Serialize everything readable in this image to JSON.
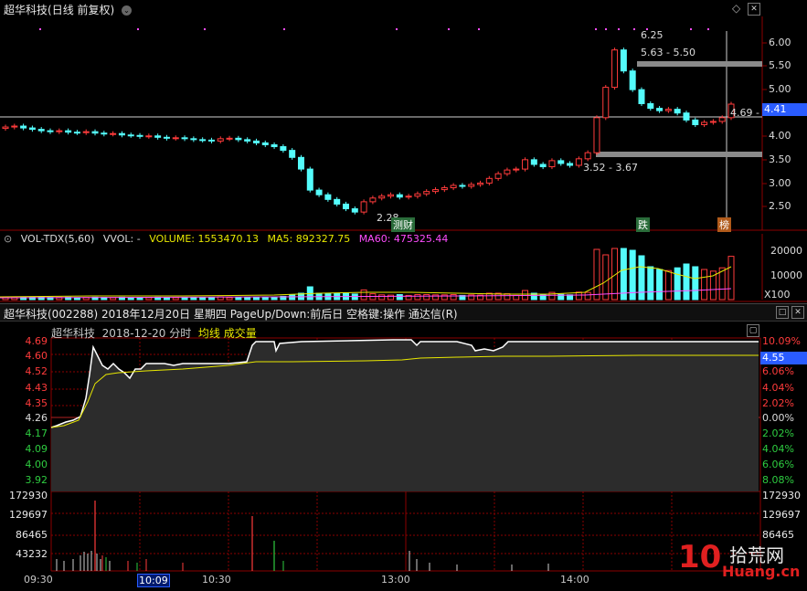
{
  "kline": {
    "title": "超华科技",
    "mode": "(日线 前复权)",
    "y_ticks": [
      "6.00",
      "5.50",
      "5.00",
      "4.50",
      "4.00",
      "3.50",
      "3.00",
      "2.50"
    ],
    "price_box": "4.41",
    "annotations": {
      "high": "6.25",
      "range1": "5.63 - 5.50",
      "range2": "3.52 - 3.67",
      "low": "2.28",
      "last": "4.69 -"
    },
    "tags": {
      "t1": "测财",
      "t2": "跌",
      "t3": "榜"
    }
  },
  "volume": {
    "indicator": "VOL-TDX(5,60)",
    "vvol": "VVOL: -",
    "volume": "VOLUME: 1553470.13",
    "ma5": "MA5: 892327.75",
    "ma60": "MA60: 475325.44",
    "y_ticks": [
      "20000",
      "10000"
    ],
    "unit": "X100"
  },
  "intraday": {
    "bar_title": "超华科技(002288)  2018年12月20日  星期四  PageUp/Down:前后日  空格键:操作  通达信(R)",
    "sub_name": "超华科技",
    "sub_date": "2018-12-20 分时",
    "sub_avg": "均线",
    "sub_vol": "成交量",
    "left_price": [
      "4.69",
      "4.60",
      "4.52",
      "4.43",
      "4.35",
      "4.26",
      "4.17",
      "4.09",
      "4.00",
      "3.92"
    ],
    "right_pct": [
      "10.09%",
      "8.08%",
      "6.06%",
      "4.04%",
      "2.02%",
      "0.00%",
      "2.02%",
      "4.04%",
      "6.06%",
      "8.08%"
    ],
    "price_box": "4.55",
    "vol_ticks": [
      "172930",
      "129697",
      "86465",
      "43232"
    ],
    "times": [
      "09:30",
      "10:09",
      "10:30",
      "13:00",
      "14:00"
    ]
  },
  "logo": {
    "text": "拾荒网",
    "domain": "Huang.cn",
    "num": "10"
  },
  "colors": {
    "up": "#ff3b3b",
    "down": "#54fcfc",
    "avg": "#e8e800",
    "ma5": "#e8e8e8",
    "ma60": "#ff4cff",
    "grid": "#8b0000"
  }
}
